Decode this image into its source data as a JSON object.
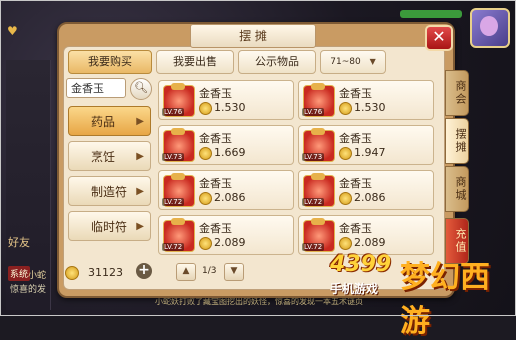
{
  "window": {
    "title": "摆 摊"
  },
  "tabs": [
    {
      "label": "我要购买",
      "active": true
    },
    {
      "label": "我要出售",
      "active": false
    },
    {
      "label": "公示物品",
      "active": false
    }
  ],
  "level_filter": {
    "value": "71~80",
    "arrow": "▼"
  },
  "search": {
    "value": "金香玉",
    "icon": "search-icon"
  },
  "categories": [
    {
      "label": "药品",
      "active": true
    },
    {
      "label": "烹饪",
      "active": false
    },
    {
      "label": "制造符",
      "active": false
    },
    {
      "label": "临时符",
      "active": false
    }
  ],
  "items": [
    {
      "name": "金香玉",
      "level": "LV.76",
      "price": "1.530"
    },
    {
      "name": "金香玉",
      "level": "LV.76",
      "price": "1.530"
    },
    {
      "name": "金香玉",
      "level": "LV.73",
      "price": "1.669"
    },
    {
      "name": "金香玉",
      "level": "LV.73",
      "price": "1.947"
    },
    {
      "name": "金香玉",
      "level": "LV.72",
      "price": "2.086"
    },
    {
      "name": "金香玉",
      "level": "LV.72",
      "price": "2.086"
    },
    {
      "name": "金香玉",
      "level": "LV.72",
      "price": "2.089"
    },
    {
      "name": "金香玉",
      "level": "LV.72",
      "price": "2.089"
    }
  ],
  "wallet": {
    "coins": "31123",
    "plus": "+"
  },
  "pagination": {
    "page": "1/3",
    "up": "▲",
    "down": "▼"
  },
  "side_tabs": [
    {
      "label": "商会",
      "active": false
    },
    {
      "label": "摆摊",
      "active": true
    },
    {
      "label": "商城",
      "active": false
    },
    {
      "label": "充值",
      "active": false
    }
  ],
  "close_label": "✕",
  "hud": {
    "friend_label": "好友",
    "chat_tag": "系统",
    "chat_line1": "小蛇",
    "chat_line2": "惊喜的发",
    "bottom_chat": "小蛇妖打败了藏宝图挖出的妖怪，惊喜的发现一本五术谜页"
  },
  "logo": {
    "number": "4399",
    "subtitle": "手机游戏",
    "mark": "梦幻西游"
  }
}
